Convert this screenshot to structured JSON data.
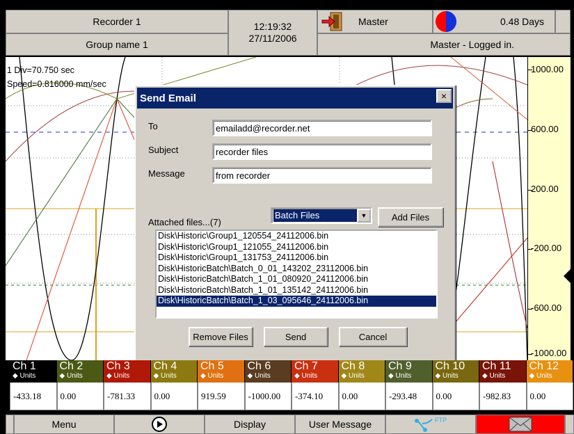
{
  "header": {
    "recorder_name": "Recorder 1",
    "group_name": "Group name 1",
    "time": "12:19:32",
    "date": "27/11/2006",
    "user": "Master",
    "status": "Master - Logged in.",
    "disk_remaining": "0.48 Days"
  },
  "chart": {
    "div_label": "1 Div=70.750 sec",
    "speed_label": "Speed=0.816000 mm/sec",
    "scale": [
      "1000.00",
      "600.00",
      "200.00",
      "-200.00",
      "-600.00",
      "-1000.00"
    ]
  },
  "dialog": {
    "title": "Send Email",
    "close": "×",
    "to_label": "To",
    "to_value": "emailadd@recorder.net",
    "subject_label": "Subject",
    "subject_value": "recorder files",
    "message_label": "Message",
    "message_value": "from recorder",
    "attached_label": "Attached files...(7)",
    "file_type": "Batch Files",
    "add_files": "Add Files",
    "files": [
      "Disk\\Historic\\Group1_120554_24112006.bin",
      "Disk\\Historic\\Group1_121055_24112006.bin",
      "Disk\\Historic\\Group1_131753_24112006.bin",
      "Disk\\HistoricBatch\\Batch_0_01_143202_23112006.bin",
      "Disk\\HistoricBatch\\Batch_1_01_080920_24112006.bin",
      "Disk\\HistoricBatch\\Batch_1_01_135142_24112006.bin",
      "Disk\\HistoricBatch\\Batch_1_03_095646_24112006.bin"
    ],
    "remove_files": "Remove Files",
    "send": "Send",
    "cancel": "Cancel"
  },
  "channels": [
    {
      "name": "Ch 1",
      "units": "◆ Units",
      "value": "-433.18",
      "color": "#000000"
    },
    {
      "name": "Ch 2",
      "units": "◆ Units",
      "value": "0.00",
      "color": "#4a5a14"
    },
    {
      "name": "Ch 3",
      "units": "◆ Units",
      "value": "-781.33",
      "color": "#b01808"
    },
    {
      "name": "Ch 4",
      "units": "◆ Units",
      "value": "0.00",
      "color": "#8c7a10"
    },
    {
      "name": "Ch 5",
      "units": "◆ Units",
      "value": "919.59",
      "color": "#e07010"
    },
    {
      "name": "Ch 6",
      "units": "◆ Units",
      "value": "-1000.00",
      "color": "#5a3c20"
    },
    {
      "name": "Ch 7",
      "units": "◆ Units",
      "value": "-374.10",
      "color": "#c83010"
    },
    {
      "name": "Ch 8",
      "units": "◆ Units",
      "value": "0.00",
      "color": "#a08818"
    },
    {
      "name": "Ch 9",
      "units": "◆ Units",
      "value": "-293.48",
      "color": "#50602c"
    },
    {
      "name": "Ch 10",
      "units": "◆ Units",
      "value": "0.00",
      "color": "#7a6810"
    },
    {
      "name": "Ch 11",
      "units": "◆ Units",
      "value": "-982.83",
      "color": "#781408"
    },
    {
      "name": "Ch 12",
      "units": "◆ Units",
      "value": "0.00",
      "color": "#e89010"
    }
  ],
  "toolbar": {
    "menu": "Menu",
    "display": "Display",
    "user_message": "User Message",
    "ftp": "FTP"
  },
  "colors": {
    "title_bar": "#0a246a",
    "alarm_red": "#ff0000",
    "scale_bg": "#ffffcc"
  }
}
